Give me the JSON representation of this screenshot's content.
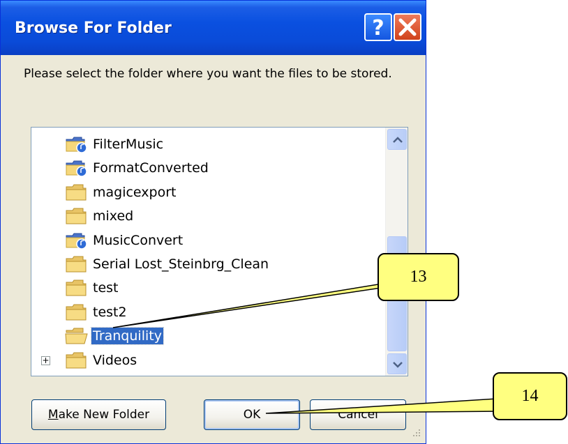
{
  "dialog": {
    "title": "Browse For Folder",
    "help_icon": "help-icon",
    "close_icon": "close-icon",
    "prompt": "Please select the folder where you want the files to be stored."
  },
  "tree": {
    "items": [
      {
        "label": "FilterMusic",
        "icon": "music-folder-icon",
        "selected": false,
        "expander": ""
      },
      {
        "label": "FormatConverted",
        "icon": "music-folder-icon",
        "selected": false,
        "expander": ""
      },
      {
        "label": "magicexport",
        "icon": "folder-icon",
        "selected": false,
        "expander": ""
      },
      {
        "label": "mixed",
        "icon": "folder-icon",
        "selected": false,
        "expander": ""
      },
      {
        "label": "MusicConvert",
        "icon": "music-folder-icon",
        "selected": false,
        "expander": ""
      },
      {
        "label": "Serial Lost_Steinbrg_Clean",
        "icon": "folder-icon",
        "selected": false,
        "expander": ""
      },
      {
        "label": "test",
        "icon": "folder-icon",
        "selected": false,
        "expander": ""
      },
      {
        "label": "test2",
        "icon": "folder-icon",
        "selected": false,
        "expander": ""
      },
      {
        "label": "Tranquility",
        "icon": "open-folder-icon",
        "selected": true,
        "expander": ""
      },
      {
        "label": "Videos",
        "icon": "folder-icon",
        "selected": false,
        "expander": "+"
      }
    ]
  },
  "buttons": {
    "make_new_folder": "Make New Folder",
    "ok": "OK",
    "cancel": "Cancel"
  },
  "callouts": {
    "c13": "13",
    "c14": "14"
  },
  "colors": {
    "titlebar": "#0a50e0",
    "selection": "#316ac5",
    "callout_fill": "#ffff80",
    "folder_yellow": "#f5d77b"
  }
}
